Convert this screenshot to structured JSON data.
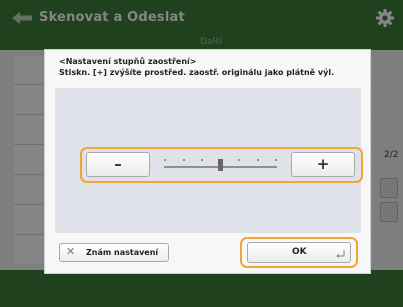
{
  "header": {
    "title": "Skenovat a Odeslat",
    "back_icon": "back-arrow-icon",
    "settings_icon": "gear-icon"
  },
  "background": {
    "strip_label": "Další",
    "page_number": "2/2"
  },
  "dialog": {
    "heading": "<Nastavení stupňů zaostření>",
    "description": "Stiskn. [+] zvýšíte prostřed. zaostř. originálu jako plátně výl.",
    "minus_label": "–",
    "plus_label": "+",
    "slider": {
      "level": 0,
      "min": -3,
      "max": 3
    },
    "reset_label": "Znám nastavení",
    "reset_icon": "close-x-icon",
    "ok_label": "OK",
    "ok_icon": "enter-icon"
  },
  "colors": {
    "header_green": "#3c7e3a",
    "focus_outline": "#f0a43a",
    "panel": "#dfe2e9"
  }
}
